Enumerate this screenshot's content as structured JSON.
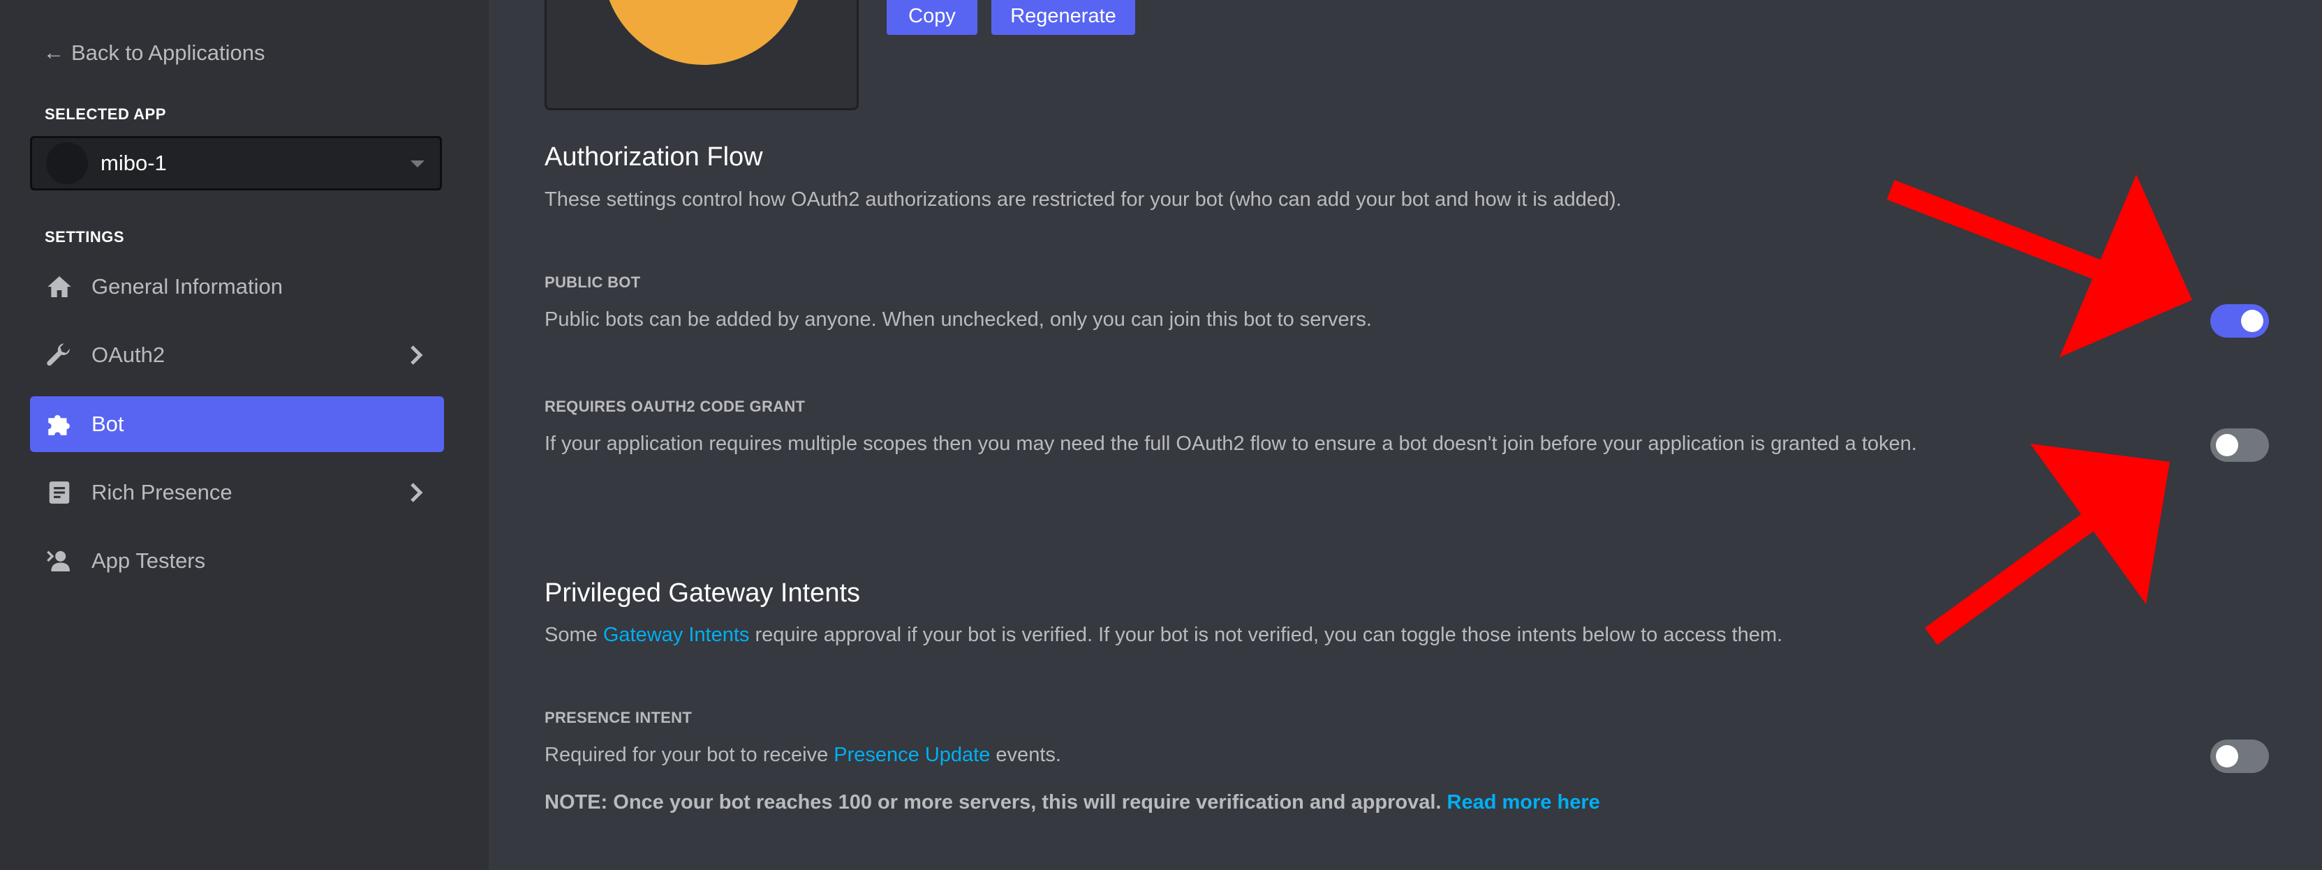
{
  "sidebar": {
    "back_label": "Back to Applications",
    "selected_app_heading": "SELECTED APP",
    "selected_app_name": "mibo-1",
    "settings_heading": "SETTINGS",
    "items": [
      {
        "label": "General Information",
        "icon": "home-icon"
      },
      {
        "label": "OAuth2",
        "icon": "wrench-icon"
      },
      {
        "label": "Bot",
        "icon": "puzzle-icon"
      },
      {
        "label": "Rich Presence",
        "icon": "document-icon"
      },
      {
        "label": "App Testers",
        "icon": "user-icon"
      }
    ]
  },
  "token": {
    "copy_label": "Copy",
    "regenerate_label": "Regenerate"
  },
  "authorization": {
    "title": "Authorization Flow",
    "description": "These settings control how OAuth2 authorizations are restricted for your bot (who can add your bot and how it is added).",
    "public_bot": {
      "label": "PUBLIC BOT",
      "description": "Public bots can be added by anyone. When unchecked, only you can join this bot to servers.",
      "enabled": true
    },
    "code_grant": {
      "label": "REQUIRES OAUTH2 CODE GRANT",
      "description": "If your application requires multiple scopes then you may need the full OAuth2 flow to ensure a bot doesn't join before your application is granted a token.",
      "enabled": false
    }
  },
  "intents": {
    "title": "Privileged Gateway Intents",
    "desc_prefix": "Some ",
    "desc_link": "Gateway Intents",
    "desc_suffix": " require approval if your bot is verified. If your bot is not verified, you can toggle those intents below to access them.",
    "presence": {
      "label": "PRESENCE INTENT",
      "desc_prefix": "Required for your bot to receive ",
      "desc_link": "Presence Update",
      "desc_suffix": " events.",
      "enabled": false
    },
    "note_text": "NOTE: Once your bot reaches 100 or more servers, this will require verification and approval.",
    "note_link": "Read more here"
  },
  "colors": {
    "accent": "#5865f2",
    "link": "#00aff4",
    "annotation_arrow": "#ff0000",
    "app_icon": "#f0a93a"
  }
}
